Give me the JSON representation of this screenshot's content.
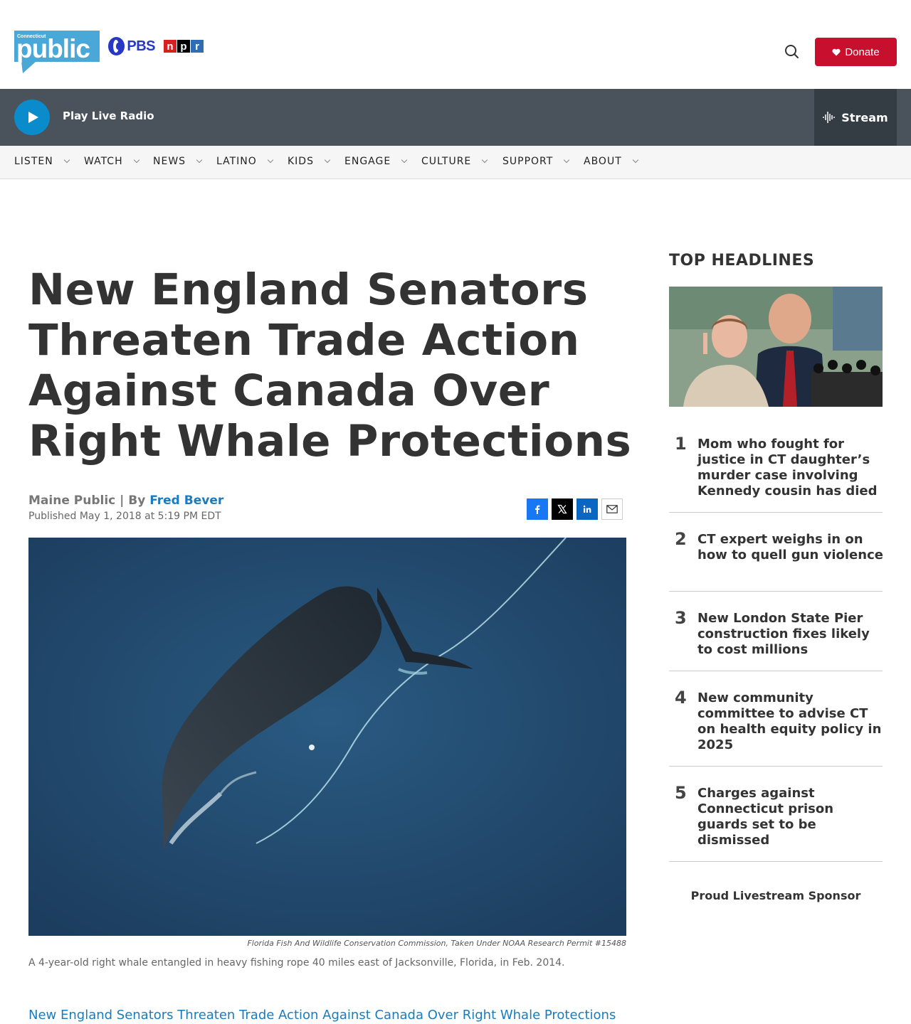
{
  "header": {
    "brand_small": "Connecticut",
    "brand": "public",
    "pbs": "PBS",
    "npr_letters": [
      "n",
      "p",
      "r"
    ],
    "donate_label": "Donate"
  },
  "player": {
    "play_label": "Play Live Radio",
    "stream_label": "Stream"
  },
  "nav": {
    "items": [
      "LISTEN",
      "WATCH",
      "NEWS",
      "LATINO",
      "KIDS",
      "ENGAGE",
      "CULTURE",
      "SUPPORT",
      "ABOUT"
    ]
  },
  "article": {
    "headline": "New England Senators Threaten Trade Action Against Canada Over Right Whale Protections",
    "source": "Maine Public | By ",
    "author": "Fred Bever",
    "published": "Published May 1, 2018 at 5:19 PM EDT",
    "image_credit": "Florida Fish And Wildlife Conservation Commission, Taken Under NOAA Research Permit #15488",
    "caption": "A 4-year-old right whale entangled in heavy fishing rope 40 miles east of Jacksonville, Florida, in Feb. 2014.",
    "link_text": "New England Senators Threaten Trade Action Against Canada Over Right Whale Protections"
  },
  "sidebar": {
    "title": "TOP HEADLINES",
    "headlines": [
      {
        "num": "1",
        "text": "Mom who fought for justice in CT daughter’s murder case involving Kennedy cousin has died"
      },
      {
        "num": "2",
        "text": "CT expert weighs in on how to quell gun violence"
      },
      {
        "num": "3",
        "text": "New London State Pier construction fixes likely to cost millions"
      },
      {
        "num": "4",
        "text": "New community committee to advise CT on health equity policy in 2025"
      },
      {
        "num": "5",
        "text": "Charges against Connecticut prison guards set to be dismissed"
      }
    ],
    "sponsor": "Proud Livestream Sponsor"
  },
  "colors": {
    "donate": "#c8102e",
    "link": "#1a7bbd",
    "player_bar": "#4a535c",
    "play_button": "#0a8ccc",
    "brand": "#4aa8d8"
  },
  "icons": {
    "search": "search-icon",
    "heart": "heart-icon",
    "play": "play-icon",
    "stream": "audio-wave-icon",
    "facebook": "facebook-icon",
    "x": "x-twitter-icon",
    "linkedin": "linkedin-icon",
    "email": "email-icon"
  }
}
